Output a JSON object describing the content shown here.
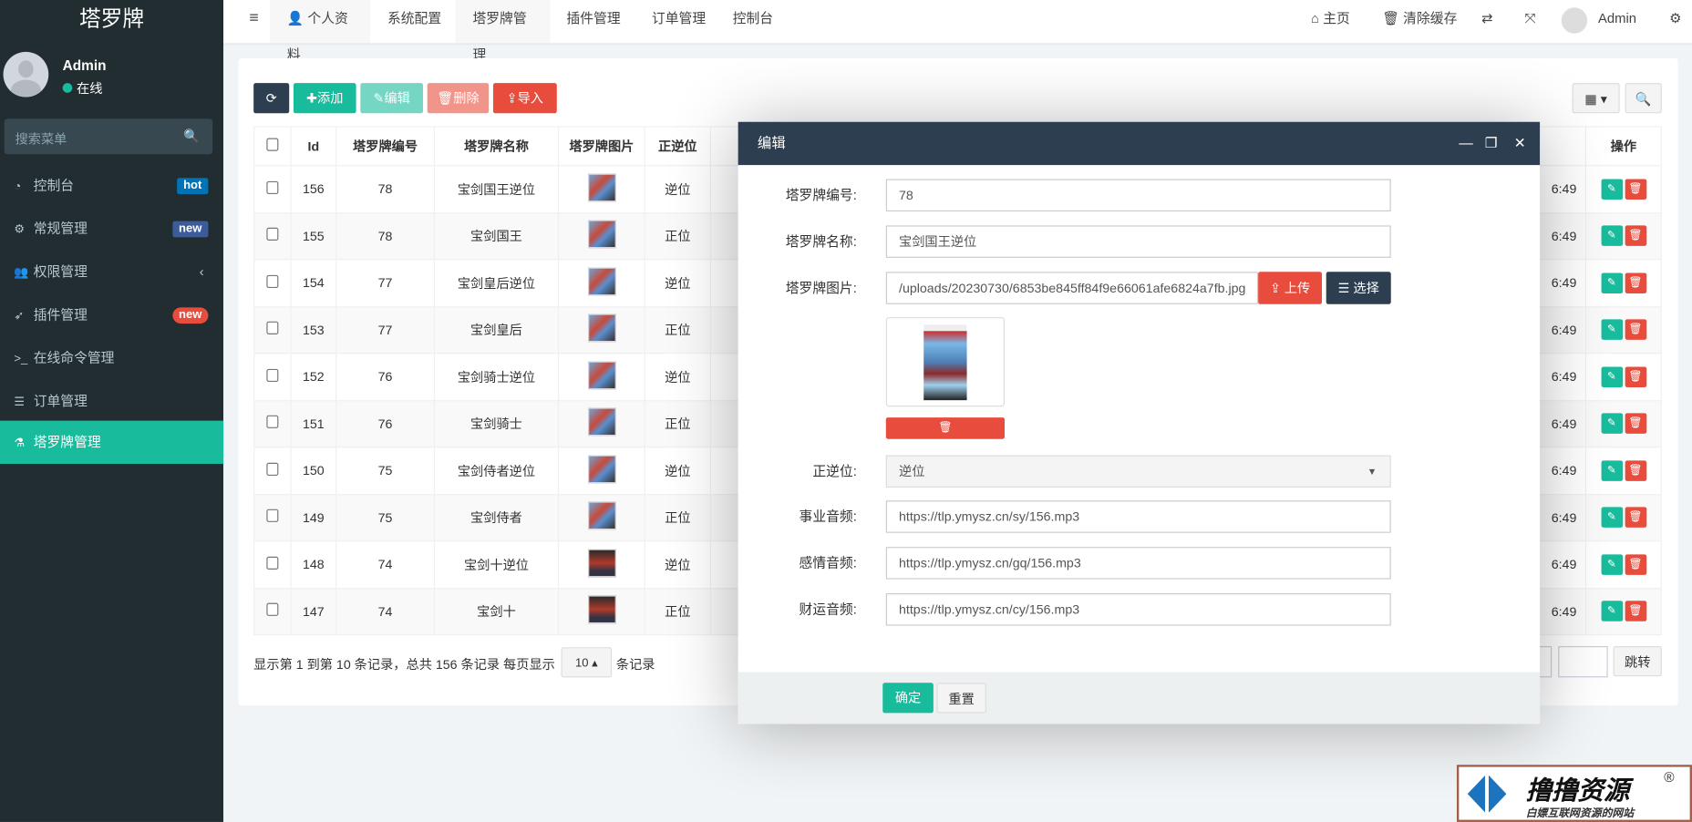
{
  "sidebar": {
    "logo": "塔罗牌",
    "user": {
      "name": "Admin",
      "status": "在线"
    },
    "search_placeholder": "搜索菜单",
    "items": [
      {
        "label": "控制台",
        "icon": "dashboard-icon",
        "glyph": "◔",
        "badge": "hot",
        "badge_color": "#0073b7"
      },
      {
        "label": "常规管理",
        "icon": "cogs-icon",
        "glyph": "⚙",
        "badge": "new",
        "badge_color": "#3c5b9a"
      },
      {
        "label": "权限管理",
        "icon": "users-icon",
        "glyph": "👥",
        "chevron": "‹"
      },
      {
        "label": "插件管理",
        "icon": "rocket-icon",
        "glyph": "➶",
        "badge": "new",
        "badge_color": "#e74c3c"
      },
      {
        "label": "在线命令管理",
        "icon": "terminal-icon",
        "glyph": ">_"
      },
      {
        "label": "订单管理",
        "icon": "list-icon",
        "glyph": "☰"
      },
      {
        "label": "塔罗牌管理",
        "icon": "flask-icon",
        "glyph": "⚗",
        "active": true
      }
    ]
  },
  "header": {
    "tabs": [
      "个人资料",
      "系统配置",
      "塔罗牌管理",
      "插件管理",
      "订单管理",
      "控制台"
    ],
    "home": "主页",
    "clear_cache": "清除缓存",
    "user": "Admin"
  },
  "toolbar": {
    "add": "添加",
    "edit": "编辑",
    "delete": "删除",
    "import": "导入"
  },
  "table": {
    "columns": [
      "Id",
      "塔罗牌编号",
      "塔罗牌名称",
      "塔罗牌图片",
      "正逆位",
      "操作"
    ],
    "rows": [
      {
        "id": "156",
        "no": "78",
        "name": "宝剑国王逆位",
        "pos": "逆位",
        "time": "6:49"
      },
      {
        "id": "155",
        "no": "78",
        "name": "宝剑国王",
        "pos": "正位",
        "time": "6:49"
      },
      {
        "id": "154",
        "no": "77",
        "name": "宝剑皇后逆位",
        "pos": "逆位",
        "time": "6:49"
      },
      {
        "id": "153",
        "no": "77",
        "name": "宝剑皇后",
        "pos": "正位",
        "time": "6:49"
      },
      {
        "id": "152",
        "no": "76",
        "name": "宝剑骑士逆位",
        "pos": "逆位",
        "time": "6:49"
      },
      {
        "id": "151",
        "no": "76",
        "name": "宝剑骑士",
        "pos": "正位",
        "time": "6:49"
      },
      {
        "id": "150",
        "no": "75",
        "name": "宝剑侍者逆位",
        "pos": "逆位",
        "time": "6:49"
      },
      {
        "id": "149",
        "no": "75",
        "name": "宝剑侍者",
        "pos": "正位",
        "time": "6:49"
      },
      {
        "id": "148",
        "no": "74",
        "name": "宝剑十逆位",
        "pos": "逆位",
        "time": "6:49"
      },
      {
        "id": "147",
        "no": "74",
        "name": "宝剑十",
        "pos": "正位",
        "time": "6:49"
      }
    ]
  },
  "pagination": {
    "summary": "显示第 1 到第 10 条记录，总共 156 条记录 每页显示",
    "page_size": "10",
    "suffix": "条记录",
    "jump": "跳转"
  },
  "dialog": {
    "title": "编辑",
    "fields": {
      "no_label": "塔罗牌编号:",
      "no": "78",
      "name_label": "塔罗牌名称:",
      "name": "宝剑国王逆位",
      "image_label": "塔罗牌图片:",
      "image": "/uploads/20230730/6853be845ff84f9e66061afe6824a7fb.jpg",
      "upload": "上传",
      "choose": "选择",
      "pos_label": "正逆位:",
      "pos": "逆位",
      "career_label": "事业音频:",
      "career": "https://tlp.ymysz.cn/sy/156.mp3",
      "love_label": "感情音频:",
      "love": "https://tlp.ymysz.cn/gq/156.mp3",
      "wealth_label": "财运音频:",
      "wealth": "https://tlp.ymysz.cn/cy/156.mp3"
    },
    "ok": "确定",
    "reset": "重置"
  },
  "watermark": {
    "title": "撸撸资源",
    "subtitle": "白嫖互联网资源的网站",
    "mark": "®"
  },
  "colors": {
    "sidebar": "#222d32",
    "accent": "#18bc9c",
    "danger": "#e74c3c",
    "primary": "#2c3e50"
  }
}
